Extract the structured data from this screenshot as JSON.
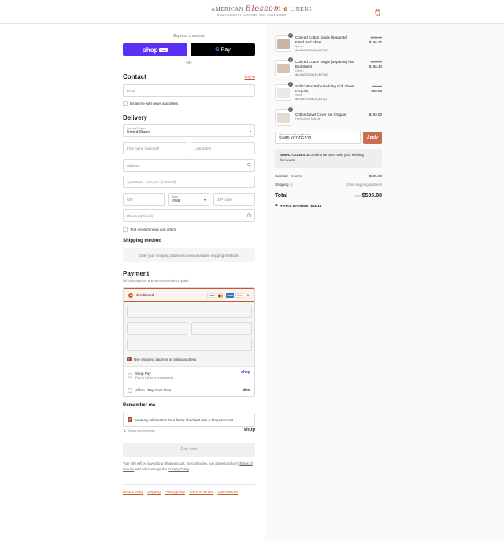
{
  "header": {
    "logo_left": "AMERICAN",
    "logo_script": "Blossom",
    "logo_right": "LINENS",
    "logo_tagline": "MADE IN AMERICA  ✦  SUSTAINABLY MADE  ✦  INDEPENDENT"
  },
  "express": {
    "label": "Express checkout",
    "shop_pay": "shop",
    "shop_pay_badge": "Pay",
    "gpay_g": "G",
    "gpay": "Pay",
    "or": "OR"
  },
  "contact": {
    "title": "Contact",
    "login": "Log in",
    "email_placeholder": "Email",
    "newsletter": "Email me with news and offers"
  },
  "delivery": {
    "title": "Delivery",
    "country_label": "Country/Region",
    "country": "United States",
    "first_name": "First name (optional)",
    "last_name": "Last name",
    "address": "Address",
    "apartment": "Apartment, suite, etc. (optional)",
    "city": "City",
    "state_label": "State",
    "state": "Iowa",
    "zip": "ZIP code",
    "phone": "Phone (optional)",
    "text_me": "Text me with news and offers"
  },
  "shipping_method": {
    "title": "Shipping method",
    "note": "Enter your shipping address to view available shipping methods."
  },
  "payment": {
    "title": "Payment",
    "subtitle": "All transactions are secure and encrypted.",
    "credit_card": "Credit card",
    "card_brands": [
      "VISA",
      "MC",
      "AMEX",
      "DISC"
    ],
    "more_cards": "+3",
    "billing_same": "Use shipping address as billing address",
    "shop_pay_title": "Shop Pay",
    "shop_pay_sub": "Pay in full or in installments",
    "shop_pay_logo": "shop",
    "affirm": "Affirm - Pay Over Time",
    "affirm_logo": "affirm"
  },
  "remember": {
    "title": "Remember me",
    "save_info": "Save my information for a faster checkout with a Shop account",
    "secure": "Secure and encrypted",
    "shop_logo": "shop"
  },
  "pay_now": "Pay now",
  "legal": {
    "text1": "Your info will be saved to a Shop account. By continuing, you agree to Shop's",
    "tos": "Terms of Service",
    "text2": "and acknowledge the",
    "privacy": "Privacy Policy",
    "end": "."
  },
  "footer": [
    "Refund policy",
    "Shipping",
    "Privacy policy",
    "Terms of service",
    "Cancellations"
  ],
  "cart": {
    "items": [
      {
        "qty": "1",
        "name": "Colored Cotton Single [Separate] Fitted Bed Sheet",
        "variant": "Queen",
        "discount": "LABORDAY15 (-$27.60)",
        "old_price": "$184.00",
        "price": "$156.40",
        "color": "#c9b6a6"
      },
      {
        "qty": "1",
        "name": "Colored Cotton Single [Separate] Flat Bed Sheet",
        "variant": "Queen",
        "discount": "LABORDAY15 (-$27.60)",
        "old_price": "$184.00",
        "price": "$156.40",
        "color": "#d8c3b3"
      },
      {
        "qty": "1",
        "name": "Soft Cotton Baby Bedding Crib Sheet Irregular",
        "variant": "White",
        "discount": "LABORDAY15 (-$5.92)",
        "old_price": "$39.50",
        "price": "$33.58",
        "color": "#e9e9e9"
      },
      {
        "qty": "1",
        "name": "Cotton Duvet Cover Set Irregular",
        "variant": "Full/Queen / Natural",
        "discount": "",
        "old_price": "",
        "price": "$159.50",
        "color": "#e2ddd2"
      }
    ],
    "code_label": "Discount code or gift card",
    "code_value": "SIMPLYCODES10",
    "apply": "Apply",
    "error_code": "SIMPLYCODES10",
    "error_text": " couldn't be used with your existing discounts.",
    "subtotal_label": "Subtotal · 4 items",
    "subtotal": "$505.88",
    "shipping_label": "Shipping",
    "shipping_value": "Enter shipping address",
    "total_label": "Total",
    "currency": "USD",
    "total": "$505.88",
    "savings_label": "TOTAL SAVINGS",
    "savings": "$61.12"
  },
  "colors": {
    "accent": "#c45c2f",
    "shop_purple": "#5a31f4",
    "checkbox": "#a94b3f"
  }
}
